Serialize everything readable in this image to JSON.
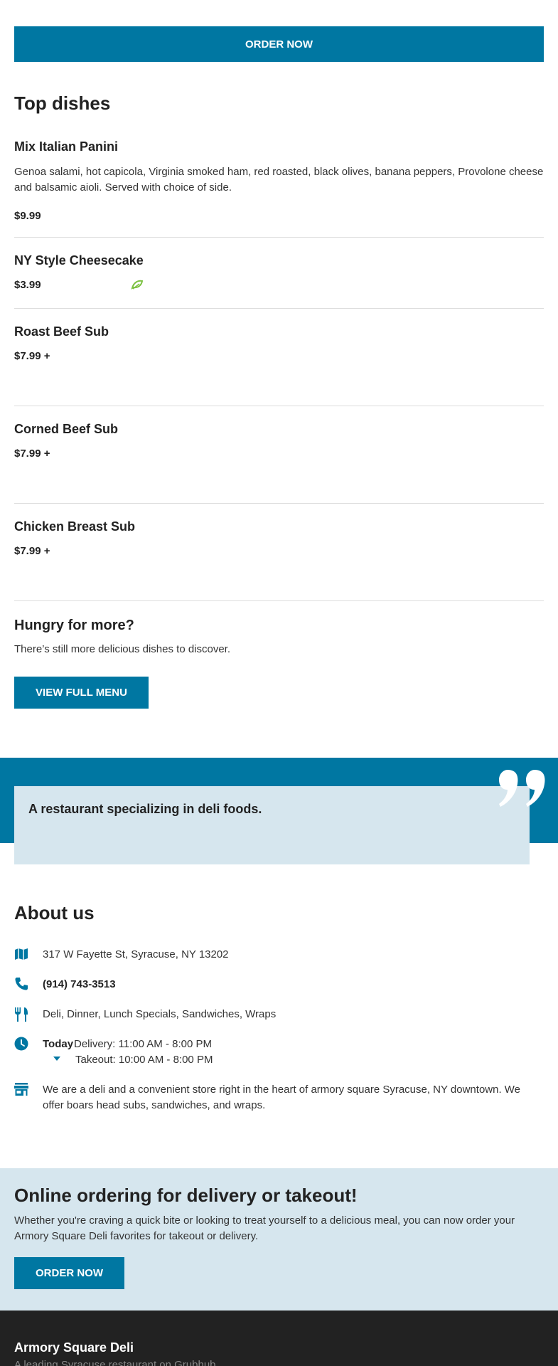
{
  "header": {
    "order_now": "ORDER NOW"
  },
  "top_dishes": {
    "title": "Top dishes",
    "items": [
      {
        "name": "Mix Italian Panini",
        "description": "Genoa salami, hot capicola, Virginia smoked ham, red roasted, black olives, banana peppers, Provolone cheese and balsamic aioli. Served with choice of side.",
        "price": "$9.99"
      },
      {
        "name": "NY Style Cheesecake",
        "price": "$3.99",
        "icon": "leaf-icon"
      },
      {
        "name": "Roast Beef Sub",
        "price": "$7.99 +"
      },
      {
        "name": "Corned Beef Sub",
        "price": "$7.99 +"
      },
      {
        "name": "Chicken Breast Sub",
        "price": "$7.99 +"
      }
    ]
  },
  "hungry": {
    "title": "Hungry for more?",
    "subtitle": "There’s still more delicious dishes to discover.",
    "button": "VIEW FULL MENU"
  },
  "quote": {
    "text": "A restaurant specializing in deli foods.",
    "icon": "quote-icon"
  },
  "about": {
    "title": "About us",
    "address": "317 W Fayette St, Syracuse, NY 13202",
    "phone": "(914) 743-3513",
    "cuisines": "Deli, Dinner, Lunch Specials, Sandwiches, Wraps",
    "hours": {
      "today_label": "Today",
      "delivery": "Delivery: 11:00 AM - 8:00 PM",
      "takeout": "Takeout: 10:00 AM - 8:00 PM"
    },
    "description": "We are a deli and a convenient store right in the heart of armory square Syracuse, NY downtown. We offer boars head subs, sandwiches, and wraps."
  },
  "ordering": {
    "title": "Online ordering for delivery or takeout!",
    "subtitle": "Whether you're craving a quick bite or looking to treat yourself to a delicious meal, you can now order your Armory Square Deli favorites for takeout or delivery.",
    "button": "ORDER NOW"
  },
  "footer": {
    "name": "Armory Square Deli",
    "tagline": "A leading Syracuse restaurant on Grubhub"
  },
  "colors": {
    "accent": "#0077a2",
    "light_band": "#d6e6ee",
    "footer_bg": "#222222",
    "leaf": "#7cc242"
  }
}
